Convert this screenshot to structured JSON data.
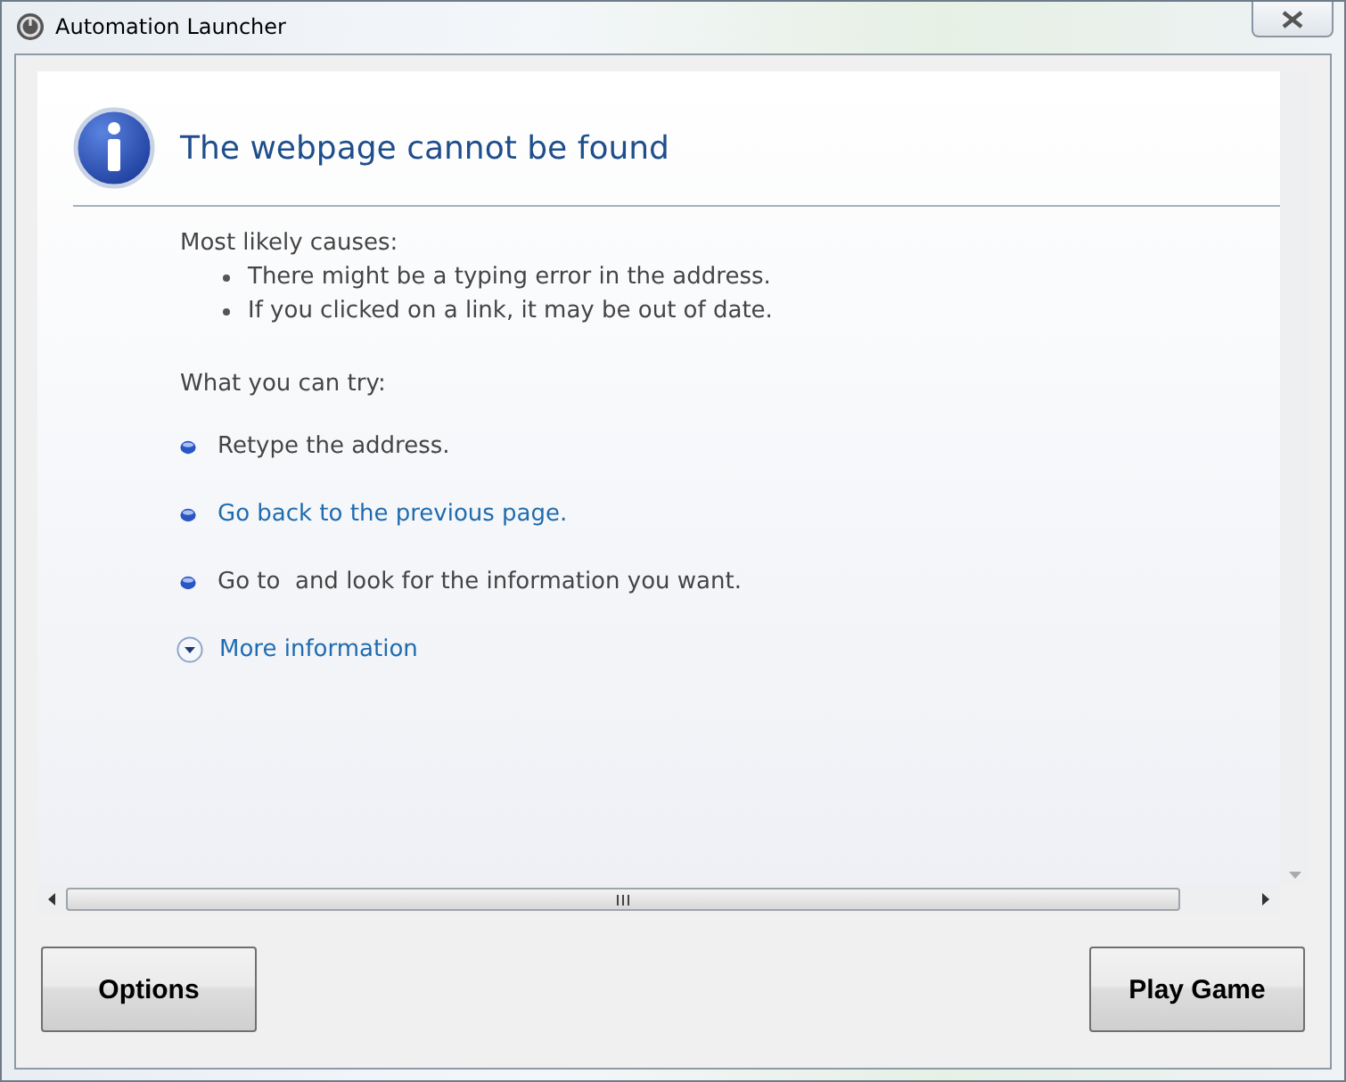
{
  "window": {
    "title": "Automation Launcher"
  },
  "page": {
    "heading": "The webpage cannot be found",
    "causes_label": "Most likely causes:",
    "causes": [
      "There might be a typing error in the address.",
      "If you clicked on a link, it may be out of date."
    ],
    "try_label": "What you can try:",
    "suggestions": [
      {
        "kind": "text",
        "text": "Retype the address."
      },
      {
        "kind": "link",
        "text": "Go back to the previous page."
      },
      {
        "kind": "text",
        "text": "Go to  and look for the information you want."
      }
    ],
    "more_info": {
      "label": "More information",
      "expanded": false
    }
  },
  "buttons": [
    {
      "label": "Options"
    },
    {
      "label": "Play Game"
    }
  ]
}
